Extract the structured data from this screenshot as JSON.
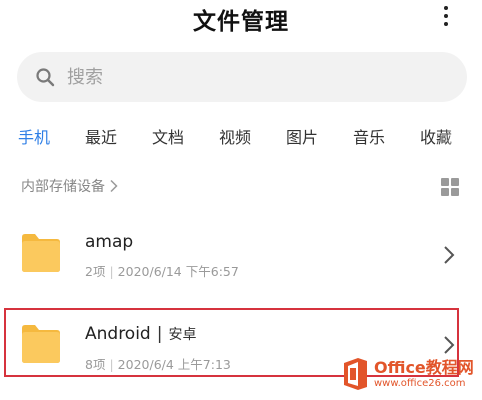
{
  "header": {
    "title": "文件管理",
    "more_icon": "more-vertical-icon"
  },
  "search": {
    "placeholder": "搜索",
    "value": "",
    "icon": "search-icon"
  },
  "tabs": [
    {
      "label": "手机",
      "active": true
    },
    {
      "label": "最近",
      "active": false
    },
    {
      "label": "文档",
      "active": false
    },
    {
      "label": "视频",
      "active": false
    },
    {
      "label": "图片",
      "active": false
    },
    {
      "label": "音乐",
      "active": false
    },
    {
      "label": "收藏",
      "active": false
    }
  ],
  "breadcrumb": {
    "label": "内部存储设备"
  },
  "folders": [
    {
      "name": "amap",
      "alias": "",
      "count": "2项",
      "date": "2020/6/14 下午6:57"
    },
    {
      "name": "Android",
      "alias": "安卓",
      "count": "8项",
      "date": "2020/6/4 上午7:13"
    }
  ],
  "watermark": {
    "brand": "Office教程网",
    "url": "www.office26.com"
  },
  "colors": {
    "accent": "#2f7fe6",
    "folder": "#fbc95e",
    "folder_tab": "#f5b93f",
    "highlight": "#d6333d",
    "watermark": "#e2552a"
  }
}
